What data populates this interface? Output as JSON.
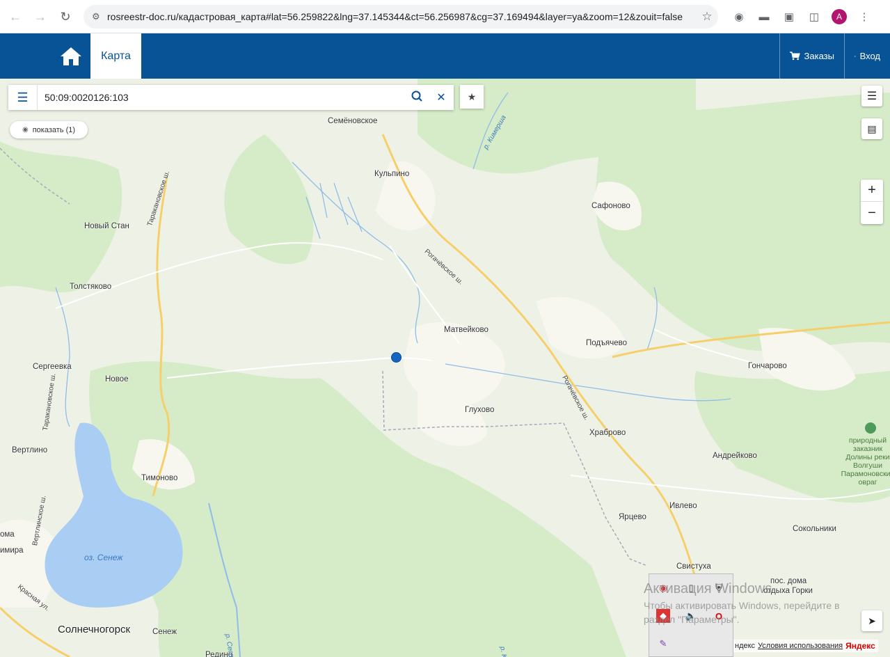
{
  "browser": {
    "url": "rosreestr-doc.ru/кадастровая_карта#lat=56.259822&lng=37.145344&ct=56.256987&cg=37.169494&layer=ya&zoom=12&zouit=false",
    "avatar_letter": "A"
  },
  "header": {
    "tab_map": "Карта",
    "orders": "Заказы",
    "login": "Вход"
  },
  "search": {
    "value": "50:09:0020126:103",
    "show_label": "показать (1)"
  },
  "map": {
    "places": {
      "semenovskoe": "Семёновское",
      "kulpino": "Кульпино",
      "safonovo": "Сафоново",
      "novy_stan": "Новый Стан",
      "tolstyakovo": "Толстяково",
      "matveykovo": "Матвейково",
      "podyachevo": "Подъячево",
      "goncharovo": "Гончарово",
      "sergeevka": "Сергеевка",
      "novoe": "Новое",
      "glukhovo": "Глухово",
      "khrabrovo": "Храброво",
      "vertlino": "Вертлино",
      "andreykovo": "Андрейково",
      "timonovo": "Тимоново",
      "ivlevo": "Ивлево",
      "yartsevo": "Ярцево",
      "sokolniki": "Сокольники",
      "svistukha": "Свистуха",
      "pos_doma": "пос. дома",
      "otdykha_gorki": "отдыха Горки",
      "solnechnogorsk": "Солнечногорск",
      "senezh": "Сенеж",
      "oma": "ома",
      "mira": "имира",
      "vedno": "Редино"
    },
    "roads": {
      "rogachevskoe_1": "Рогачёвское ш.",
      "rogachevskoe_2": "Рогачёвское ш.",
      "tarakanovskoe_1": "Таракановское ш.",
      "tarakanovskoe_2": "Таракановское ш.",
      "vertlinskoe": "Вертлинское ш.",
      "krasnaya": "Красная ул."
    },
    "rivers": {
      "kimersha": "р. Кимерша",
      "sestra": "р. Сестра",
      "sestra_2": "р. К"
    },
    "lake": "оз. Сенеж",
    "park": "природный заказник Долины реки Волгуши Парамоновский овраг",
    "attribution": {
      "left": "ндекс",
      "terms": "Условия использования",
      "brand": "Яндекс"
    }
  },
  "watermark": {
    "title": "Активация Windows",
    "body": "Чтобы активировать Windows, перейдите в раздел \"Параметры\"."
  },
  "colors": {
    "header": "#075395",
    "water": "#a9cdf3",
    "forest": "#d6ecc8",
    "road_major": "#f7cf6a"
  }
}
